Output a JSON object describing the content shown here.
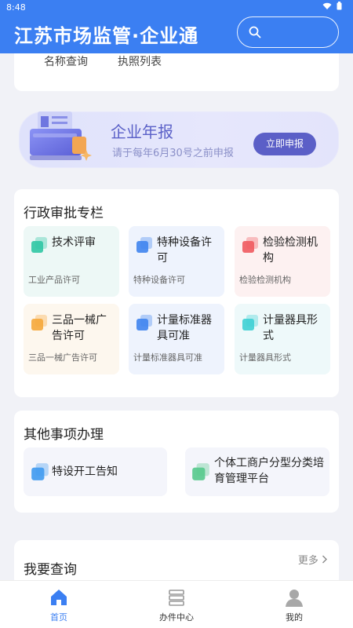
{
  "status_bar": {
    "time": "8:48",
    "icons": [
      "wifi-icon",
      "battery-icon"
    ]
  },
  "header": {
    "title": "江苏市场监管·企业通",
    "search_placeholder": "",
    "search_icon": "search-icon"
  },
  "top_links": [
    {
      "label": "名称查询"
    },
    {
      "label": "执照列表"
    }
  ],
  "banner": {
    "title": "企业年报",
    "subtitle": "请于每年6月30号之前申报",
    "button": "立即申报",
    "illustration": "report-illustration"
  },
  "admin_section": {
    "title": "行政审批专栏",
    "items": [
      {
        "name": "技术评审",
        "desc": "工业产品许可",
        "icon": "tech-review-icon",
        "color": "#2fc7a4",
        "bg": "#edf8f6"
      },
      {
        "name": "特种设备许可",
        "desc": "特种设备许可",
        "icon": "special-equipment-icon",
        "color": "#3f84ee",
        "bg": "#eef3fd"
      },
      {
        "name": "检验检测机构",
        "desc": "检验检测机构",
        "icon": "inspection-agency-icon",
        "color": "#ef5a5f",
        "bg": "#fdf1f1"
      },
      {
        "name": "三品一械广告许可",
        "desc": "三品一械广告许可",
        "icon": "advertising-permit-icon",
        "color": "#f5a73b",
        "bg": "#fdf7ee"
      },
      {
        "name": "计量标准器具可准",
        "desc": "计量标准器具可准",
        "icon": "measurement-standard-icon",
        "color": "#3f84ee",
        "bg": "#eef3fd"
      },
      {
        "name": "计量器具形式",
        "desc": "计量器具形式",
        "icon": "measuring-instrument-icon",
        "color": "#3ed0d4",
        "bg": "#eef9fa"
      }
    ]
  },
  "other_section": {
    "title": "其他事项办理",
    "items": [
      {
        "name": "特设开工告知",
        "icon": "construction-notice-icon",
        "color": "#3f9af0"
      },
      {
        "name": "个体工商户分型分类培育管理平台",
        "icon": "individual-business-icon",
        "color": "#55c98c"
      }
    ]
  },
  "query_section": {
    "title": "我要查询",
    "more": "更多",
    "more_icon": "chevron-right-icon"
  },
  "bottom_nav": {
    "items": [
      {
        "label": "首页",
        "icon": "home-icon",
        "active": true
      },
      {
        "label": "办件中心",
        "icon": "task-center-icon",
        "active": false
      },
      {
        "label": "我的",
        "icon": "user-icon",
        "active": false
      }
    ]
  },
  "colors": {
    "primary": "#3b7ff2",
    "banner_accent": "#5b5fc7",
    "background": "#f1f2f7"
  }
}
